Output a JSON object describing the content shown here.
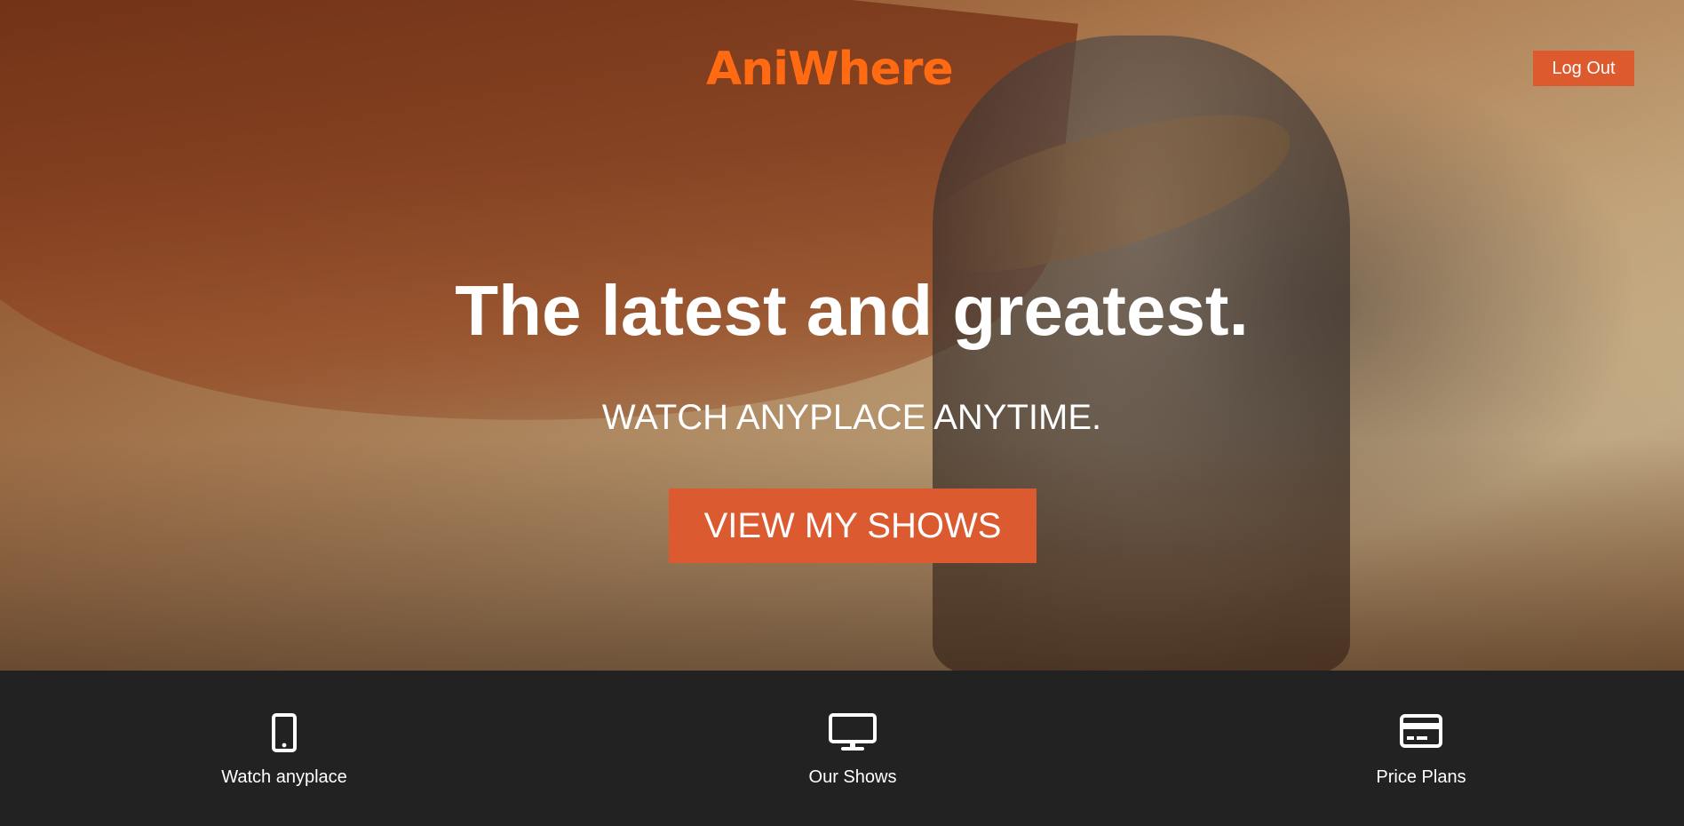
{
  "header": {
    "logo_text": "AniWhere",
    "logout_label": "Log Out"
  },
  "hero": {
    "headline": "The latest and greatest.",
    "subheadline": "WATCH ANYPLACE ANYTIME.",
    "cta_label": "VIEW MY SHOWS"
  },
  "features": [
    {
      "label": "Watch anyplace",
      "icon": "mobile-phone-icon"
    },
    {
      "label": "Our Shows",
      "icon": "monitor-icon"
    },
    {
      "label": "Price Plans",
      "icon": "credit-card-icon"
    }
  ],
  "colors": {
    "brand_orange": "#ff6a13",
    "button_orange": "#db5a30",
    "footer_bg": "#222222",
    "text_white": "#ffffff"
  }
}
